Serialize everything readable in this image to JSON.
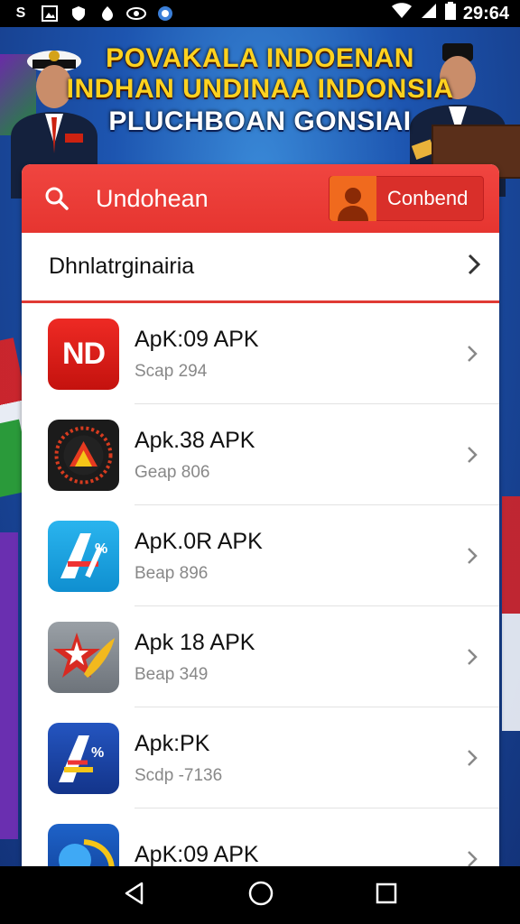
{
  "status_bar": {
    "icons": [
      "s-icon",
      "image-icon",
      "shield-icon",
      "notification-icon",
      "eye-icon",
      "globe-icon"
    ],
    "time": "29:64"
  },
  "banner": {
    "line1": "POVAKALA INDOENAN",
    "line2": "INDHAN UNDINAA INDONSIA",
    "line3": "PLUCHBOAN GONSIAI"
  },
  "search": {
    "placeholder": "Undohean",
    "button_label": "Conbend"
  },
  "section": {
    "title": "Dhnlatrginairia"
  },
  "apps": [
    {
      "name": "ApK:09 APK",
      "sub": "Scap 294",
      "icon": "nd-app-icon",
      "icon_text": "ND"
    },
    {
      "name": "Apk.38 APK",
      "sub": "Geap 806",
      "icon": "a-triangle-badge-icon"
    },
    {
      "name": "ApK.0R APK",
      "sub": "Beap 896",
      "icon": "a-percent-blue-icon"
    },
    {
      "name": "Apk 18 APK",
      "sub": "Beap 349",
      "icon": "star-wing-icon"
    },
    {
      "name": "Apk:PK",
      "sub": "Scdp -7136",
      "icon": "a-percent-navy-icon"
    },
    {
      "name": "ApK:09 APK",
      "sub": "",
      "icon": "blue-swirl-icon"
    }
  ],
  "colors": {
    "accent_red": "#e63530",
    "orange": "#f06a1e",
    "banner_yellow": "#ffd21f"
  }
}
